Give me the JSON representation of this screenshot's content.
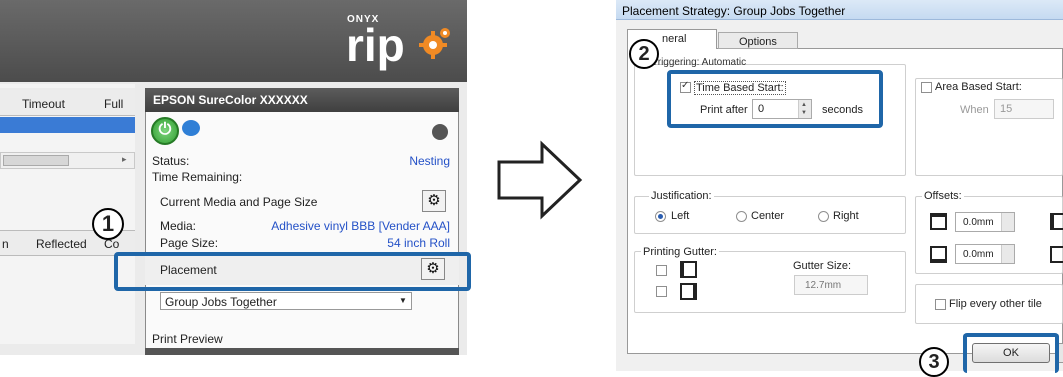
{
  "left": {
    "logo": {
      "onyx": "ONYX",
      "rip": "rip"
    },
    "job_table": {
      "col_timeout": "Timeout",
      "col_full": "Full",
      "col_n": "n",
      "col_reflected": "Reflected",
      "col_cop": "Co"
    },
    "printer": {
      "title": "EPSON SureColor XXXXXX",
      "status_label": "Status:",
      "status_value": "Nesting",
      "time_remaining_label": "Time Remaining:",
      "media_size_label": "Current Media and Page Size",
      "media_label": "Media:",
      "media_value": "Adhesive vinyl BBB [Vender AAA]",
      "page_size_label": "Page Size:",
      "page_size_value": "54 inch Roll",
      "placement_label": "Placement",
      "strategy_value": "Group Jobs Together",
      "print_preview_label": "Print Preview"
    },
    "step_badge": "1"
  },
  "dialog": {
    "title": "Placement Strategy: Group Jobs Together",
    "tabs": [
      {
        "label": "neral"
      },
      {
        "label": "Options"
      }
    ],
    "triggering_label": "Triggering: Automatic",
    "time_based": {
      "label": "Time Based Start:",
      "checked": true,
      "print_after_label": "Print after",
      "print_after_value": "0",
      "seconds_label": "seconds"
    },
    "area_based": {
      "label": "Area Based Start:",
      "checked": false,
      "when_label": "When",
      "when_value": "15"
    },
    "justification": {
      "label": "Justification:",
      "options": [
        "Left",
        "Center",
        "Right"
      ],
      "selected": "Left"
    },
    "gutter": {
      "label": "Printing Gutter:",
      "size_label": "Gutter Size:",
      "size_value": "12.7mm"
    },
    "offsets": {
      "label": "Offsets:",
      "top_value": "0.0mm",
      "bottom_value": "0.0mm"
    },
    "flip_label": "Flip every other tile",
    "ok_label": "OK",
    "step_badge_2": "2",
    "step_badge_3": "3"
  },
  "colors": {
    "callout": "#1f66a8",
    "link_blue": "#2451c7",
    "power_green": "#2f9e2f"
  }
}
